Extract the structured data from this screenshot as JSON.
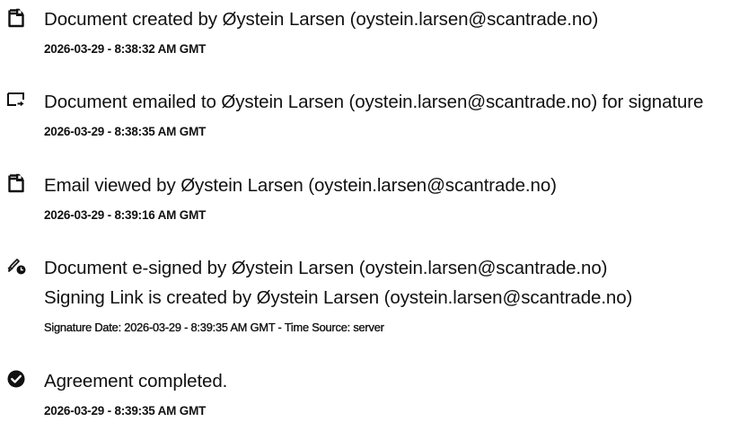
{
  "events": [
    {
      "icon": "document-created-icon",
      "lines": [
        "Document created by Øystein Larsen (oystein.larsen@scantrade.no)"
      ],
      "meta": "2026-03-29 - 8:38:32 AM GMT"
    },
    {
      "icon": "document-emailed-icon",
      "lines": [
        "Document emailed to Øystein Larsen (oystein.larsen@scantrade.no) for signature"
      ],
      "meta": "2026-03-29 - 8:38:35 AM GMT"
    },
    {
      "icon": "email-viewed-icon",
      "lines": [
        "Email viewed by Øystein Larsen (oystein.larsen@scantrade.no)"
      ],
      "meta": "2026-03-29 - 8:39:16 AM GMT"
    },
    {
      "icon": "e-signed-icon",
      "lines": [
        "Document e-signed by Øystein Larsen (oystein.larsen@scantrade.no)",
        "Signing Link is created by Øystein Larsen (oystein.larsen@scantrade.no)"
      ],
      "meta": "Signature Date: 2026-03-29 - 8:39:35 AM GMT - Time Source: server"
    },
    {
      "icon": "agreement-completed-icon",
      "lines": [
        "Agreement completed."
      ],
      "meta": "2026-03-29 - 8:39:35 AM GMT"
    }
  ]
}
